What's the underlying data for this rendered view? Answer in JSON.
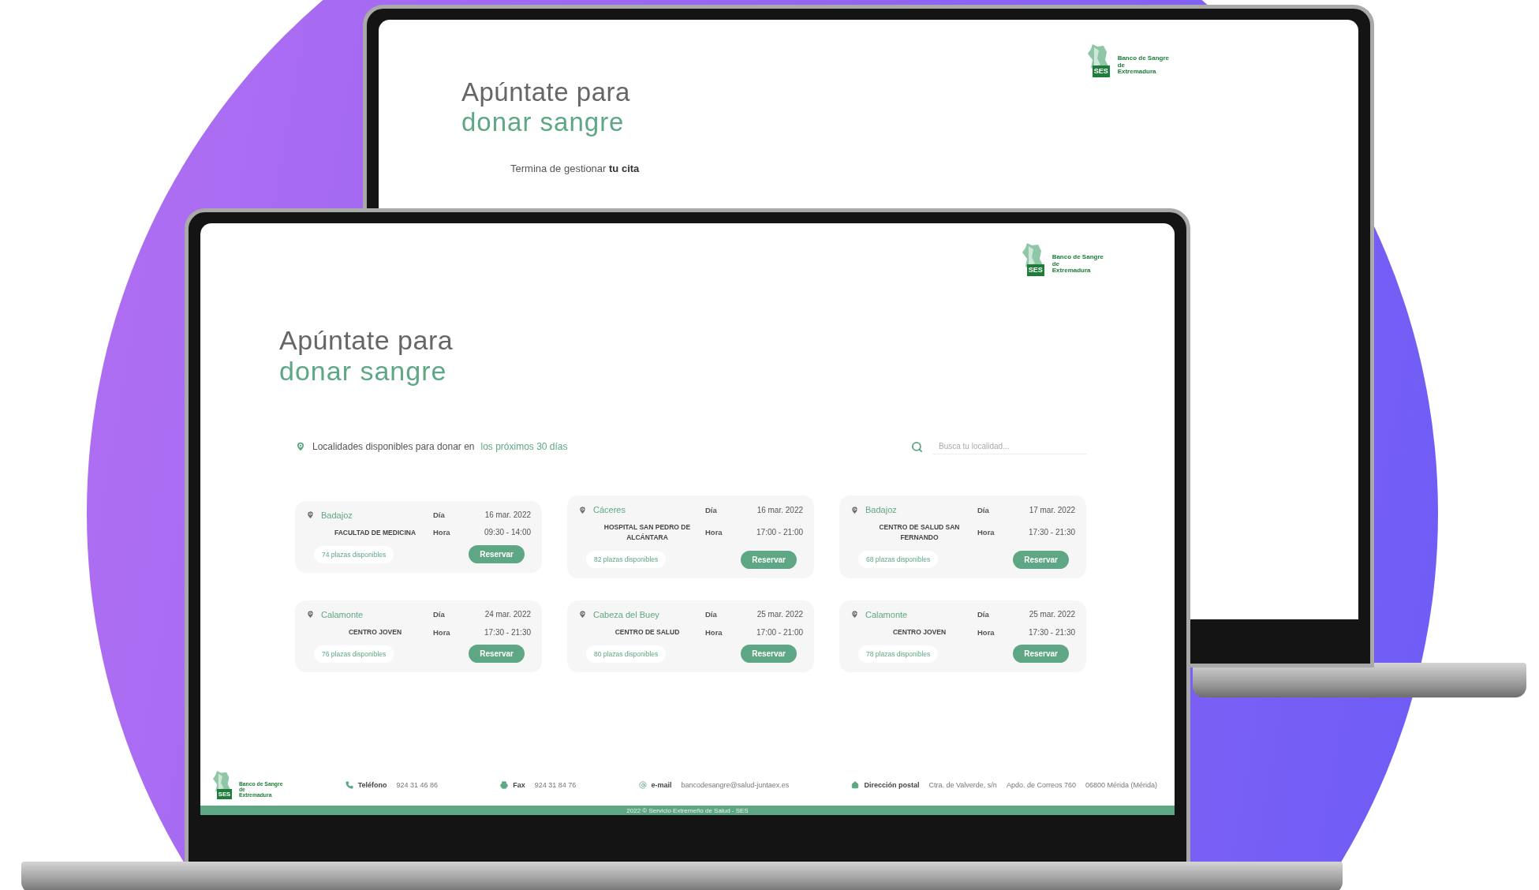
{
  "back_laptop": {
    "logo": {
      "badge": "SES",
      "lines": [
        "Banco de Sangre",
        "de",
        "Extremadura"
      ]
    },
    "title_line1": "Apúntate para",
    "title_line2": "donar sangre",
    "subtitle": "Termina de gestionar **tu cita**"
  },
  "front_laptop": {
    "logo": {
      "badge": "SES",
      "lines": [
        "Banco de Sangre",
        "de",
        "Extremadura"
      ]
    },
    "title_line1": "Apúntate para",
    "title_line2": "donar sangre",
    "locations_intro": "Localidades disponibles para donar en",
    "locations_link": "los próximos 30 días",
    "search": {
      "placeholder": "Busca tu localidad..."
    },
    "cards": [
      {
        "town": "Badajoz",
        "place": "FACULTAD DE MEDICINA",
        "day_label": "Día",
        "date": "16 mar. 2022",
        "hour_label": "Hora",
        "time": "09:30 - 14:00",
        "spots": "74 plazas disponibles",
        "button": "Reservar"
      },
      {
        "town": "Cáceres",
        "place": "HOSPITAL SAN PEDRO DE ALCÁNTARA",
        "day_label": "Día",
        "date": "16 mar. 2022",
        "hour_label": "Hora",
        "time": "17:00 - 21:00",
        "spots": "82 plazas disponibles",
        "button": "Reservar"
      },
      {
        "town": "Badajoz",
        "place": "CENTRO DE SALUD SAN FERNANDO",
        "day_label": "Día",
        "date": "17 mar. 2022",
        "hour_label": "Hora",
        "time": "17:30 - 21:30",
        "spots": "68 plazas disponibles",
        "button": "Reservar"
      },
      {
        "town": "Calamonte",
        "place": "CENTRO JOVEN",
        "day_label": "Día",
        "date": "24 mar. 2022",
        "hour_label": "Hora",
        "time": "17:30 - 21:30",
        "spots": "76 plazas disponibles",
        "button": "Reservar"
      },
      {
        "town": "Cabeza del Buey",
        "place": "CENTRO DE SALUD",
        "day_label": "Día",
        "date": "25 mar. 2022",
        "hour_label": "Hora",
        "time": "17:00 - 21:00",
        "spots": "80 plazas disponibles",
        "button": "Reservar"
      },
      {
        "town": "Calamonte",
        "place": "CENTRO JOVEN",
        "day_label": "Día",
        "date": "25 mar. 2022",
        "hour_label": "Hora",
        "time": "17:30 - 21:30",
        "spots": "78 plazas disponibles",
        "button": "Reservar"
      }
    ],
    "footer": {
      "logo": {
        "badge": "SES",
        "lines": [
          "Banco de Sangre",
          "de",
          "Extremadura"
        ]
      },
      "items": [
        {
          "kind": "phone",
          "label": "Teléfono",
          "values": [
            "924 31 46 86"
          ]
        },
        {
          "kind": "fax",
          "label": "Fax",
          "values": [
            "924 31 84 76"
          ]
        },
        {
          "kind": "email",
          "label": "e-mail",
          "values": [
            "bancodesangre@salud-juntaex.es"
          ]
        },
        {
          "kind": "address",
          "label": "Dirección postal",
          "values": [
            "Ctra. de Valverde, s/n",
            "Apdo. de Correos 760",
            "06800 Mérida (Mérida)"
          ]
        }
      ],
      "copyright": "2022 © Servicio Extremeño de Salud - SES"
    }
  }
}
